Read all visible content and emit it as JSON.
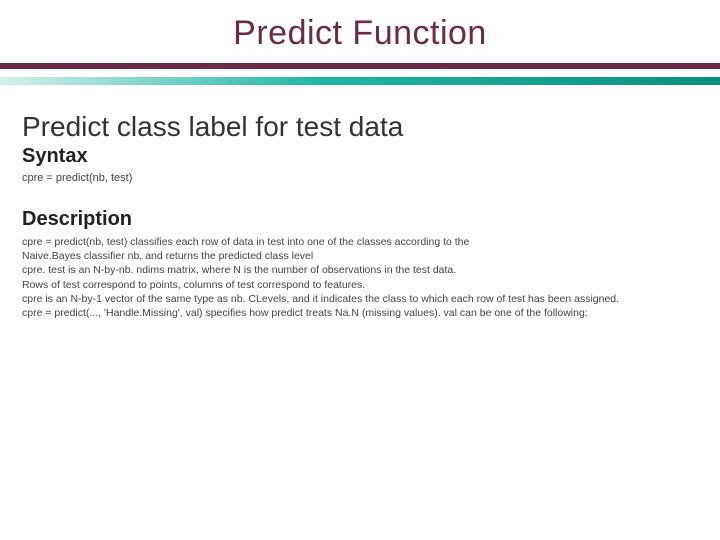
{
  "title": "Predict Function",
  "subtitle": "Predict class label for test data",
  "syntax": {
    "heading": "Syntax",
    "line": "cpre = predict(nb, test)"
  },
  "description": {
    "heading": "Description",
    "l1": "cpre = predict(nb, test) classifies each row of data in test into one of the classes according to the",
    "l2": "Naive.Bayes classifier nb, and returns the predicted class level",
    "l3": " cpre. test is an N-by-nb. ndims matrix, where N is the number of observations in the test data.",
    "l4": " Rows of test correspond to points, columns of test correspond to features.",
    "l5": "cpre is an N-by-1 vector of the same type as nb. CLevels, and it indicates the class to which each row of test has been assigned.",
    "l6": "cpre = predict(..., 'Handle.Missing', val) specifies how predict treats Na.N (missing values). val can be one of the following:"
  }
}
